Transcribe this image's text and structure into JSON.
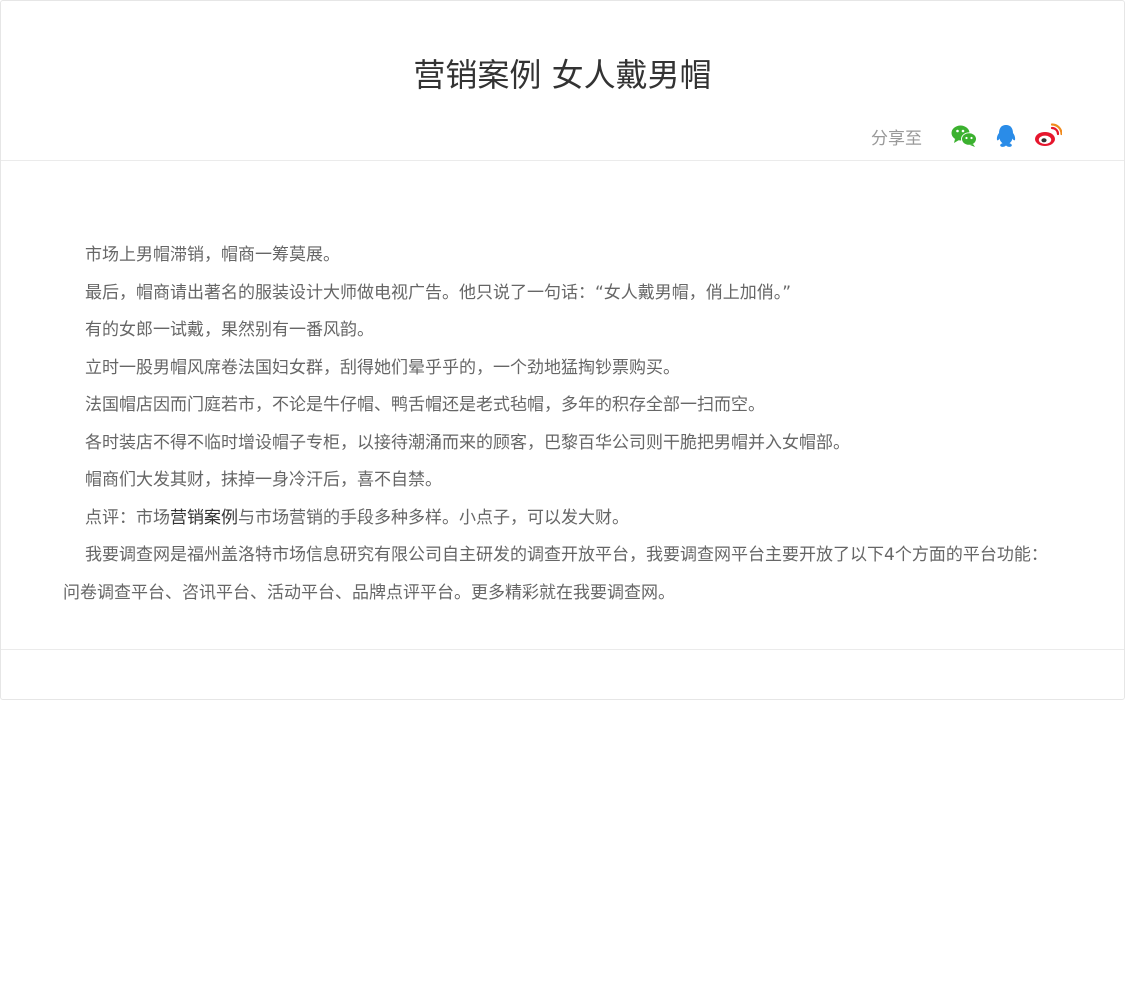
{
  "article": {
    "title": "营销案例 女人戴男帽",
    "share": {
      "label": "分享至",
      "icons": [
        "wechat-icon",
        "qq-icon",
        "weibo-icon"
      ],
      "colors": {
        "wechat": "#3bb12f",
        "qq": "#2a8ce8",
        "weibo": "#e6162d"
      }
    },
    "paragraphs": [
      "市场上男帽滞销，帽商一筹莫展。",
      "最后，帽商请出著名的服装设计大师做电视广告。他只说了一句话：“女人戴男帽，俏上加俏。”",
      "有的女郎一试戴，果然别有一番风韵。",
      "立时一股男帽风席卷法国妇女群，刮得她们晕乎乎的，一个劲地猛掏钞票购买。",
      "法国帽店因而门庭若市，不论是牛仔帽、鸭舌帽还是老式毡帽，多年的积存全部一扫而空。",
      "各时装店不得不临时增设帽子专柜，以接待潮涌而来的顾客，巴黎百华公司则干脆把男帽并入女帽部。",
      "帽商们大发其财，抹掉一身冷汗后，喜不自禁。"
    ],
    "review": {
      "before": "点评：市场",
      "keyword": "营销案例",
      "after": "与市场营销的手段多种多样。小点子，可以发大财。"
    },
    "closing": "我要调查网是福州盖洛特市场信息研究有限公司自主研发的调查开放平台，我要调查网平台主要开放了以下4个方面的平台功能：问卷调查平台、咨讯平台、活动平台、品牌点评平台。更多精彩就在我要调查网。"
  }
}
